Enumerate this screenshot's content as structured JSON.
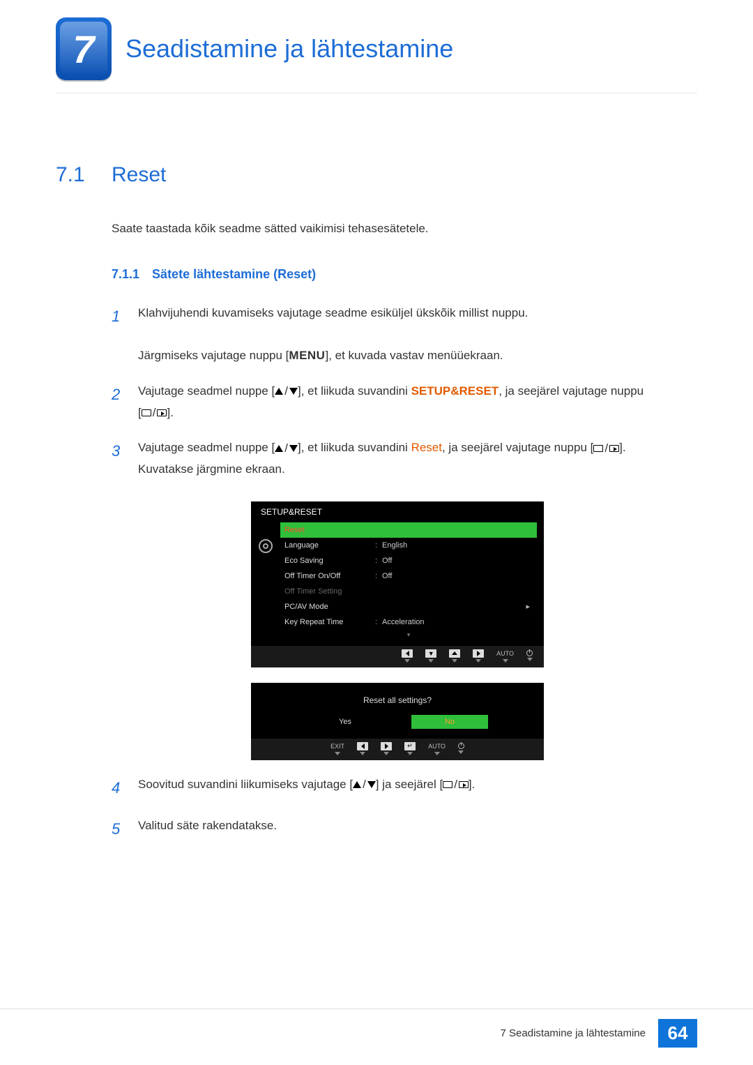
{
  "chapter": {
    "number": "7",
    "title": "Seadistamine ja lähtestamine"
  },
  "section": {
    "number": "7.1",
    "title": "Reset"
  },
  "intro": "Saate taastada kõik seadme sätted vaikimisi tehasesätetele.",
  "subsection": {
    "number": "7.1.1",
    "title": "Sätete lähtestamine (Reset)"
  },
  "steps": {
    "s1_a": "Klahvijuhendi kuvamiseks vajutage seadme esiküljel ükskõik millist nuppu.",
    "s1_b_pre": "Järgmiseks vajutage nuppu [",
    "s1_b_menu": "MENU",
    "s1_b_post": "], et kuvada vastav menüüekraan.",
    "s2_pre": "Vajutage seadmel nuppe [",
    "s2_mid": "], et liikuda suvandini ",
    "s2_target": "SETUP&RESET",
    "s2_post": ", ja seejärel vajutage nuppu",
    "s2_tail": "[",
    "s2_end": "].",
    "s3_pre": "Vajutage seadmel nuppe [",
    "s3_mid": "], et liikuda suvandini ",
    "s3_target": "Reset",
    "s3_post": ", ja seejärel vajutage nuppu [",
    "s3_end": "].",
    "s3_after": "Kuvatakse järgmine ekraan.",
    "s4_pre": "Soovitud suvandini liikumiseks vajutage [",
    "s4_mid": "] ja seejärel [",
    "s4_end": "].",
    "s5": "Valitud säte rakendatakse."
  },
  "osd": {
    "title": "SETUP&RESET",
    "rows": [
      {
        "label": "Reset",
        "value": "",
        "selected": true
      },
      {
        "label": "Language",
        "value": "English"
      },
      {
        "label": "Eco Saving",
        "value": "Off"
      },
      {
        "label": "Off Timer On/Off",
        "value": "Off"
      },
      {
        "label": "Off Timer Setting",
        "value": "",
        "dim": true
      },
      {
        "label": "PC/AV Mode",
        "value": "",
        "arrow": true
      },
      {
        "label": "Key Repeat Time",
        "value": "Acceleration"
      }
    ],
    "nav_auto": "AUTO"
  },
  "osd2": {
    "question": "Reset all settings?",
    "yes": "Yes",
    "no": "No",
    "exit": "EXIT",
    "auto": "AUTO"
  },
  "footer": {
    "label": "7 Seadistamine ja lähtestamine",
    "page": "64"
  }
}
